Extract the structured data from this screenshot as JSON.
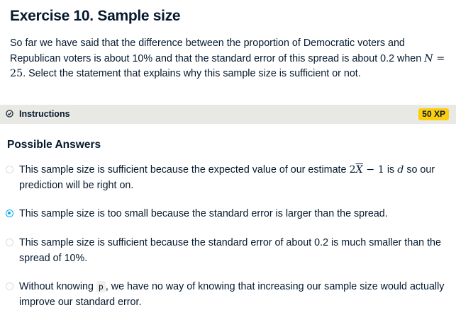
{
  "exercise": {
    "title": "Exercise 10. Sample size",
    "desc_part1": "So far we have said that the difference between the proportion of Democratic voters and Republican voters is about 10% and that the standard error of this spread is about 0.2 when ",
    "desc_math": "N = 25",
    "desc_part2": ". Select the statement that explains why this sample size is sufficient or not."
  },
  "instructions": {
    "label": "Instructions",
    "xp": "50 XP",
    "icon": "check-circle-icon"
  },
  "answers": {
    "heading": "Possible Answers",
    "options": [
      {
        "text_a": "This sample size is sufficient because the expected value of our estimate ",
        "math1": "2X̄ − 1",
        "text_b": " is ",
        "math2": "d",
        "text_c": " so our prediction will be right on.",
        "selected": false
      },
      {
        "text": "This sample size is too small because the standard error is larger than the spread.",
        "selected": true
      },
      {
        "text": "This sample size is sufficient because the standard error of about 0.2 is much smaller than the spread of 10%.",
        "selected": false
      },
      {
        "text_a": "Without knowing ",
        "code": "p",
        "text_b": ", we have no way of knowing that increasing our sample size would actually improve our standard error.",
        "selected": false
      }
    ]
  },
  "colors": {
    "accent": "#03aaf1",
    "xp_badge": "#fcce0d",
    "bar": "#e8e8e4",
    "text": "#05192d"
  }
}
